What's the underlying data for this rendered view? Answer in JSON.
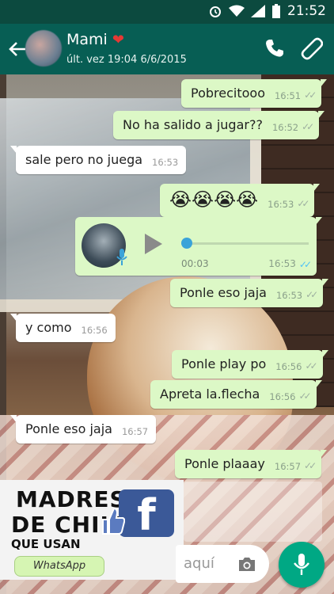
{
  "status_bar": {
    "time": "21:52"
  },
  "header": {
    "contact_name": "Mami",
    "contact_emoji": "❤",
    "last_seen": "últ. vez 19:04 6/6/2015"
  },
  "messages": [
    {
      "text": "Pobrecitooo",
      "time": "16:51",
      "direction": "out",
      "ticks": "✓✓"
    },
    {
      "text": "No ha salido a jugar??",
      "time": "16:52",
      "direction": "out",
      "ticks": "✓✓"
    },
    {
      "text": "sale pero no juega",
      "time": "16:53",
      "direction": "in"
    },
    {
      "text": "😭😭😭😭",
      "time": "16:53",
      "direction": "out",
      "ticks": "✓✓"
    },
    {
      "text": "Ponle eso jaja",
      "time": "16:53",
      "direction": "out",
      "ticks": "✓✓"
    },
    {
      "text": "y como",
      "time": "16:56",
      "direction": "in"
    },
    {
      "text": "Ponle play po",
      "time": "16:56",
      "direction": "out",
      "ticks": "✓✓"
    },
    {
      "text": "Apreta la.flecha",
      "time": "16:56",
      "direction": "out",
      "ticks": "✓✓"
    },
    {
      "text": "Ponle eso jaja",
      "time": "16:57",
      "direction": "in"
    },
    {
      "text": "Ponle plaaay",
      "time": "16:57",
      "direction": "out",
      "ticks": "✓✓"
    }
  ],
  "voice_note": {
    "duration": "00:03",
    "time": "16:53",
    "ticks": "✓✓"
  },
  "watermark": {
    "line1": "MADRES",
    "line2": "DE CHILE",
    "line3": "QUE USAN",
    "facebook_letter": "f",
    "badge": "WhatsApp"
  },
  "composer": {
    "placeholder": "aquí"
  },
  "colors": {
    "header": "#075e54",
    "outgoing": "#dcf8c6",
    "incoming": "#ffffff",
    "fab": "#00a884",
    "read_ticks": "#4fc3f7"
  },
  "icons": [
    "back-arrow-icon",
    "phone-icon",
    "paperclip-icon",
    "play-icon",
    "mic-icon",
    "camera-icon",
    "alarm-icon",
    "wifi-icon",
    "signal-icon",
    "battery-icon",
    "thumbs-up-icon"
  ]
}
